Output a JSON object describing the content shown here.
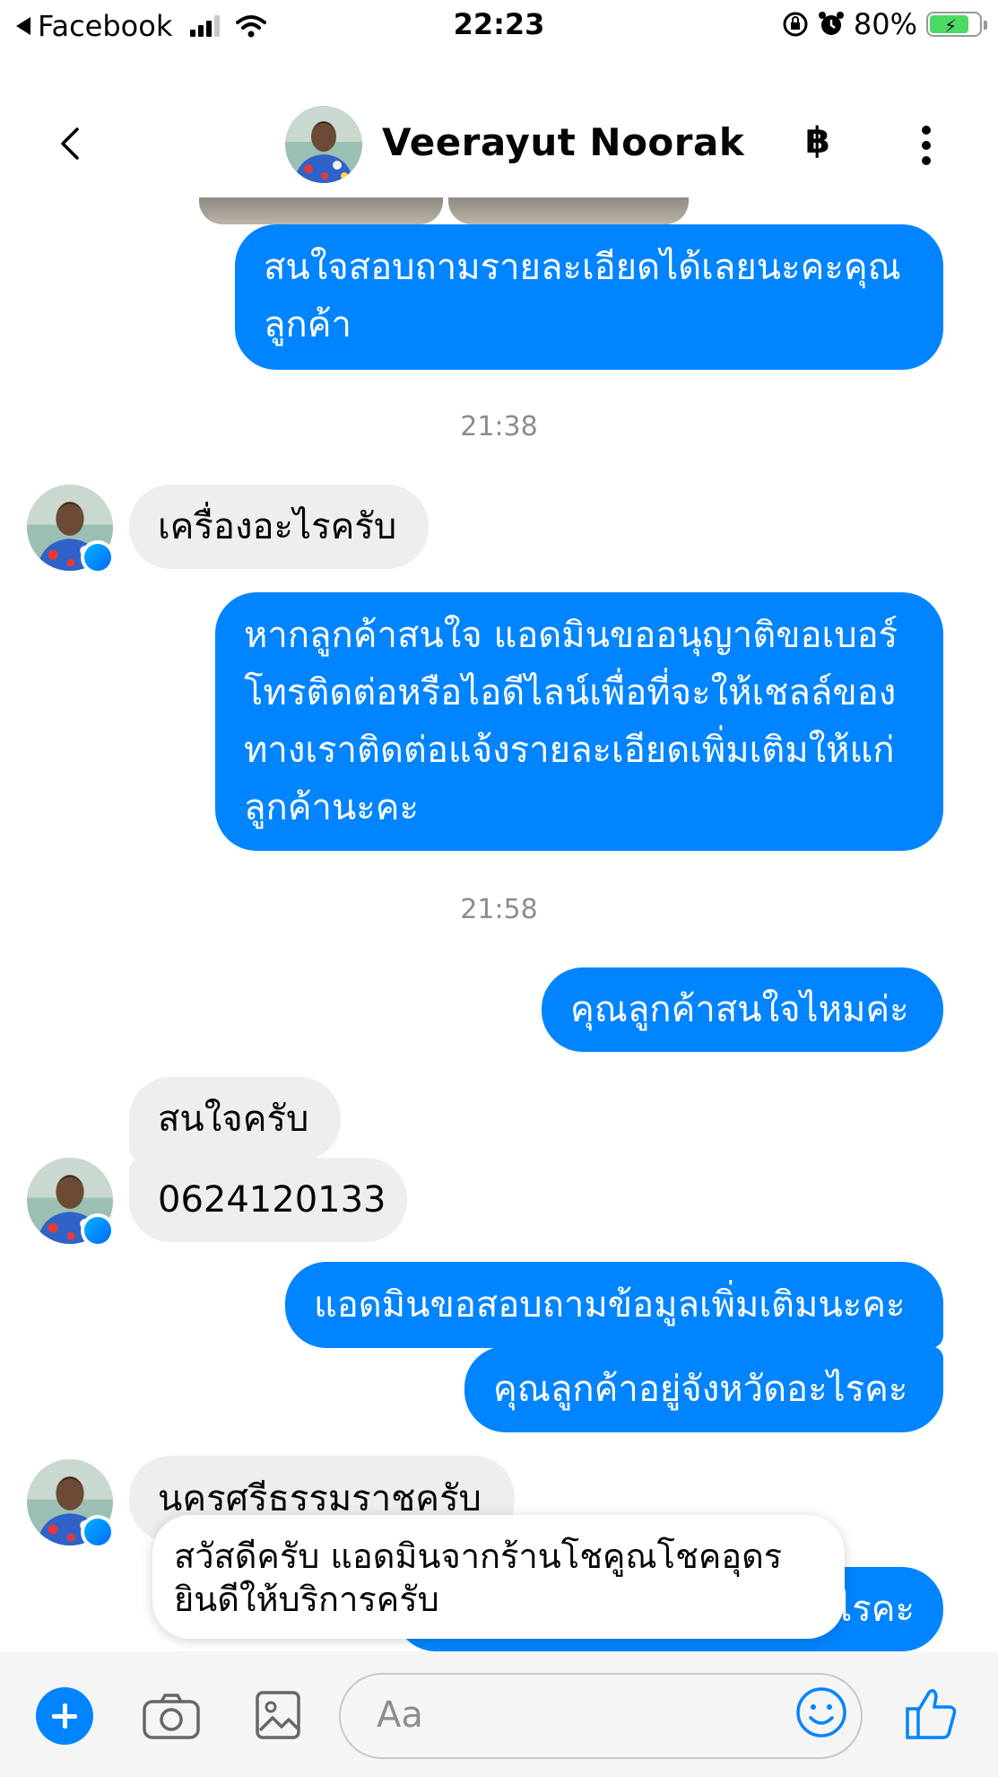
{
  "status_bar": {
    "back_app": "Facebook",
    "time": "22:23",
    "battery": "80%",
    "battery_level": 0.8
  },
  "header": {
    "contact_name": "Veerayut Noorak",
    "payment_icon": "฿"
  },
  "timestamps": [
    "21:38",
    "21:58"
  ],
  "messages": [
    {
      "dir": "out",
      "text": "สนใจสอบถามรายละเอียดได้เลยนะคะคุณลูกค้า"
    },
    {
      "dir": "in",
      "text": "เครื่องอะไรครับ"
    },
    {
      "dir": "out",
      "text": "หากลูกค้าสนใจ แอดมินขออนุญาติขอเบอร์โทรติดต่อหรือไอดีไลน์เพื่อที่จะให้เชลล์ของทางเราติดต่อแจ้งรายละเอียดเพิ่มเติมให้แก่ลูกค้านะคะ"
    },
    {
      "dir": "out",
      "text": "คุณลูกค้าสนใจไหมค่ะ"
    },
    {
      "dir": "in",
      "text": "สนใจครับ"
    },
    {
      "dir": "in",
      "text": "0624120133"
    },
    {
      "dir": "out",
      "text": "แอดมินขอสอบถามข้อมูลเพิ่มเติมนะคะ"
    },
    {
      "dir": "out",
      "text": "คุณลูกค้าอยู่จังหวัดอะไรคะ"
    },
    {
      "dir": "in",
      "text": "นครศรีธรรมราชครับ"
    },
    {
      "dir": "out",
      "text": "ไรคะ"
    }
  ],
  "suggestion": {
    "text": "สวัสดีครับ แอดมินจากร้านโชคูณโชคอุดร ยินดีให้บริการครับ"
  },
  "composer": {
    "placeholder": "Aa"
  },
  "colors": {
    "outgoing": "#0084ff",
    "incoming": "#eeeeef",
    "timestamp": "#8a8d91"
  }
}
